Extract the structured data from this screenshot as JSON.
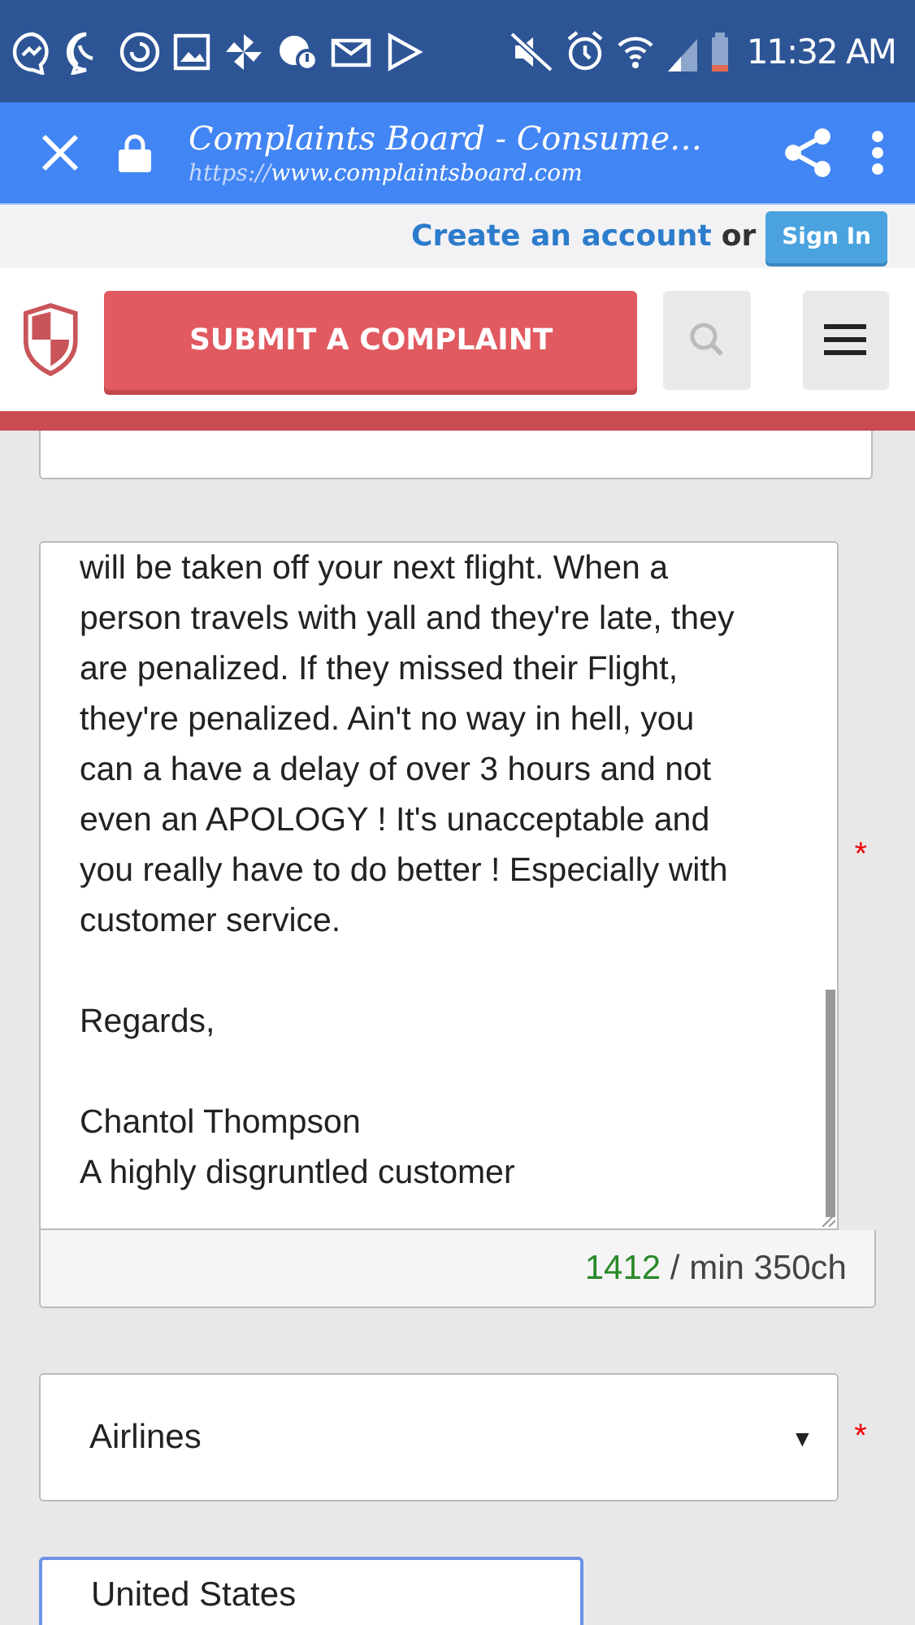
{
  "status_bar": {
    "time": "11:32 AM"
  },
  "browser_toolbar": {
    "title": "Complaints Board - Consume…",
    "url_scheme": "https://",
    "url_host": "www.complaintsboard.com"
  },
  "account_bar": {
    "create_link": "Create an account",
    "separator": "or",
    "sign_in": "Sign In"
  },
  "header": {
    "submit_button": "SUBMIT A COMPLAINT"
  },
  "form": {
    "complaint_text": {
      "value": "will be taken off your next flight. When a\nperson travels with yall and they're late, they\nare penalized. If they missed their Flight,\nthey're penalized. Ain't no way in hell, you\ncan a have a delay of over 3 hours and not\neven an APOLOGY ! It's unacceptable and\nyou really have to do better ! Especially with\ncustomer service.\n\nRegards,\n\nChantol Thompson\nA highly disgruntled customer",
      "required_mark": "*",
      "focused": false
    },
    "counter": {
      "count": "1412",
      "requirement": "/ min 350ch"
    },
    "category": {
      "value": "Airlines",
      "arrow": "▼",
      "required_mark": "*",
      "focused": false
    },
    "country": {
      "value": "United States",
      "focused": true
    }
  }
}
